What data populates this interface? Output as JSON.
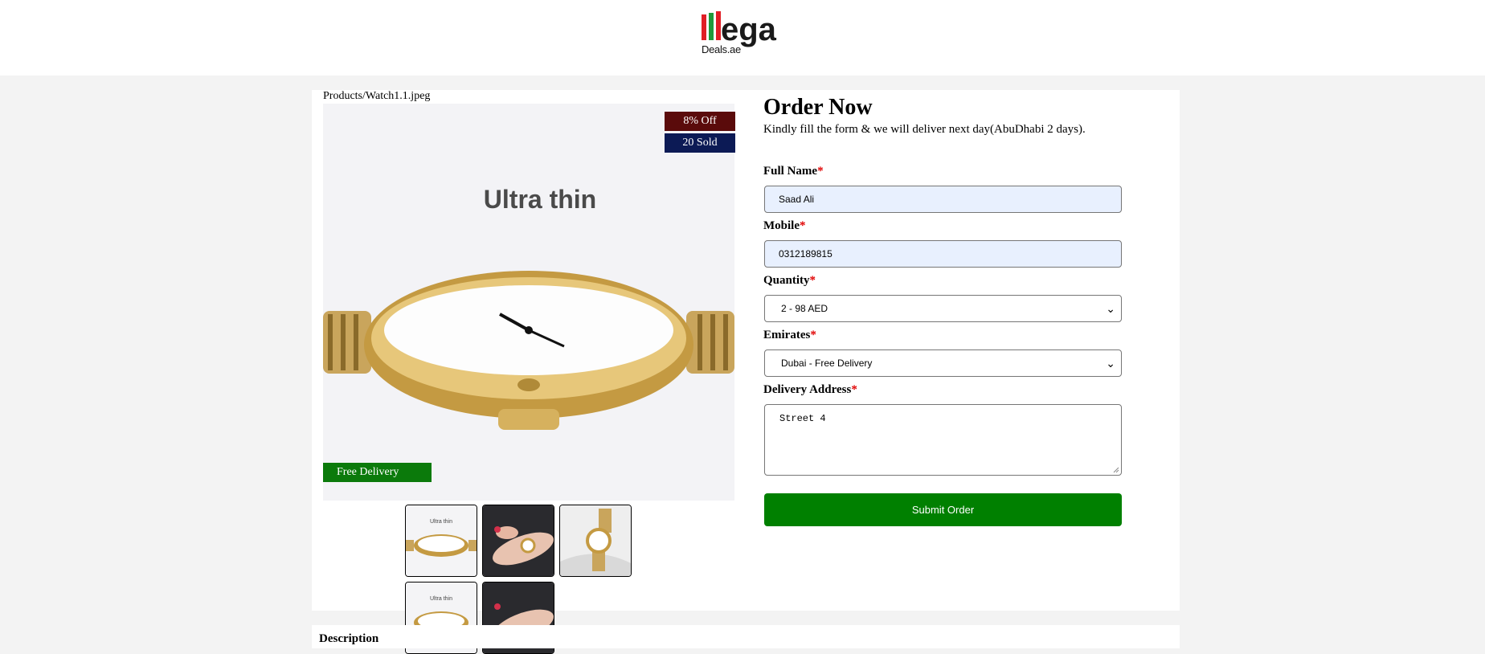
{
  "brand": {
    "logo_letters": "llega",
    "logo_sub": "Deals.ae",
    "colors": {
      "red": "#e01f26",
      "green": "#1f9a3a",
      "dark": "#1a1a1a"
    }
  },
  "product": {
    "image_path": "Products/Watch1.1.jpeg",
    "image_caption": "Ultra thin",
    "badges": {
      "discount": "8% Off",
      "sold": "20 Sold",
      "delivery": "Free Delivery"
    },
    "thumbnails": [
      {
        "name": "watch-front"
      },
      {
        "name": "wrist-shot"
      },
      {
        "name": "watch-standing"
      },
      {
        "name": "watch-front"
      },
      {
        "name": "wrist-shot"
      }
    ]
  },
  "order": {
    "title": "Order Now",
    "subtitle": "Kindly fill the form & we will deliver next day(AbuDhabi 2 days).",
    "full_name_label": "Full Name",
    "full_name_value": "Saad Ali",
    "mobile_label": "Mobile",
    "mobile_value": "0312189815",
    "quantity_label": "Quantity",
    "quantity_value": "2 - 98 AED",
    "emirates_label": "Emirates",
    "emirates_value": "Dubai - Free Delivery",
    "address_label": "Delivery Address",
    "address_value": "Street 4",
    "required_mark": "*",
    "submit_label": "Submit Order",
    "submit_color": "#008000"
  },
  "description": {
    "title": "Description"
  }
}
